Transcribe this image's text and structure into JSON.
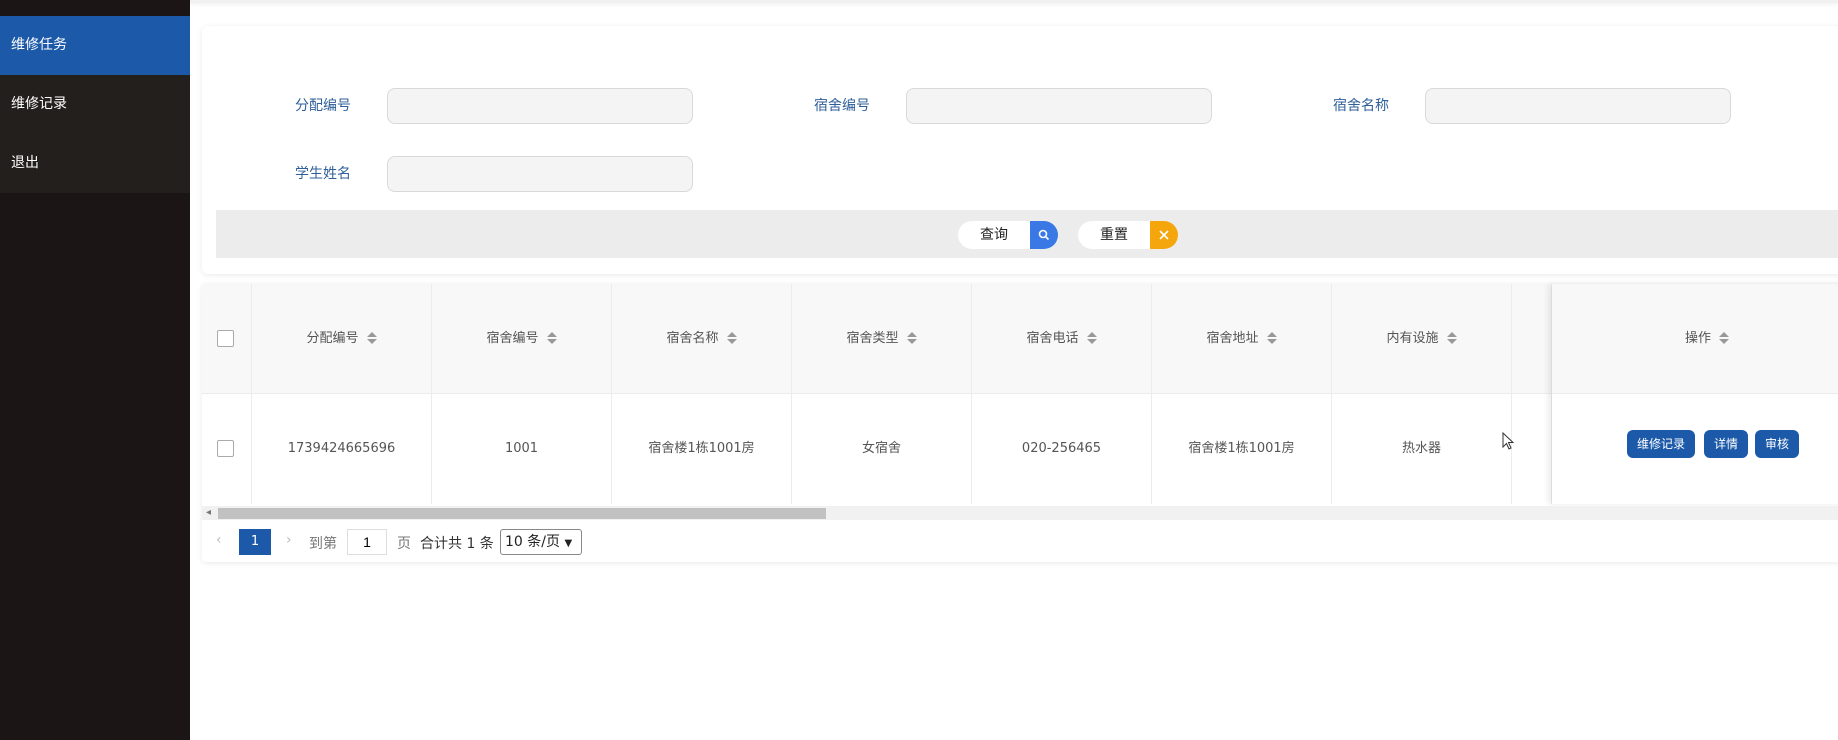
{
  "sidebar": {
    "items": [
      {
        "label": "维修任务",
        "active": true
      },
      {
        "label": "维修记录",
        "active": false
      },
      {
        "label": "退出",
        "active": false
      }
    ]
  },
  "search": {
    "fields": [
      {
        "label": "分配编号",
        "value": "",
        "placeholder": ""
      },
      {
        "label": "宿舍编号",
        "value": "",
        "placeholder": ""
      },
      {
        "label": "宿舍名称",
        "value": "",
        "placeholder": ""
      },
      {
        "label": "学生姓名",
        "value": "",
        "placeholder": ""
      }
    ],
    "query_label": "查询",
    "reset_label": "重置",
    "query_icon": "search-icon",
    "reset_icon": "close-icon",
    "query_color": "#3a78e6",
    "reset_color": "#f5a60d"
  },
  "table": {
    "columns": [
      "分配编号",
      "宿舍编号",
      "宿舍名称",
      "宿舍类型",
      "宿舍电话",
      "宿舍地址",
      "内有设施",
      "操作"
    ],
    "rows": [
      {
        "cells": [
          "1739424665696",
          "1001",
          "宿舍楼1栋1001房",
          "女宿舍",
          "020-256465",
          "宿舍楼1栋1001房",
          "热水器"
        ],
        "actions": [
          "维修记录",
          "详情",
          "审核"
        ]
      }
    ]
  },
  "pager": {
    "current_page": "1",
    "goto_prefix": "到第",
    "goto_value": "1",
    "goto_suffix": "页",
    "total_text": "合计共 1 条",
    "page_size": "10 条/页"
  },
  "colors": {
    "primary": "#1c5aa9",
    "sidebar_bg": "#1b1515"
  }
}
